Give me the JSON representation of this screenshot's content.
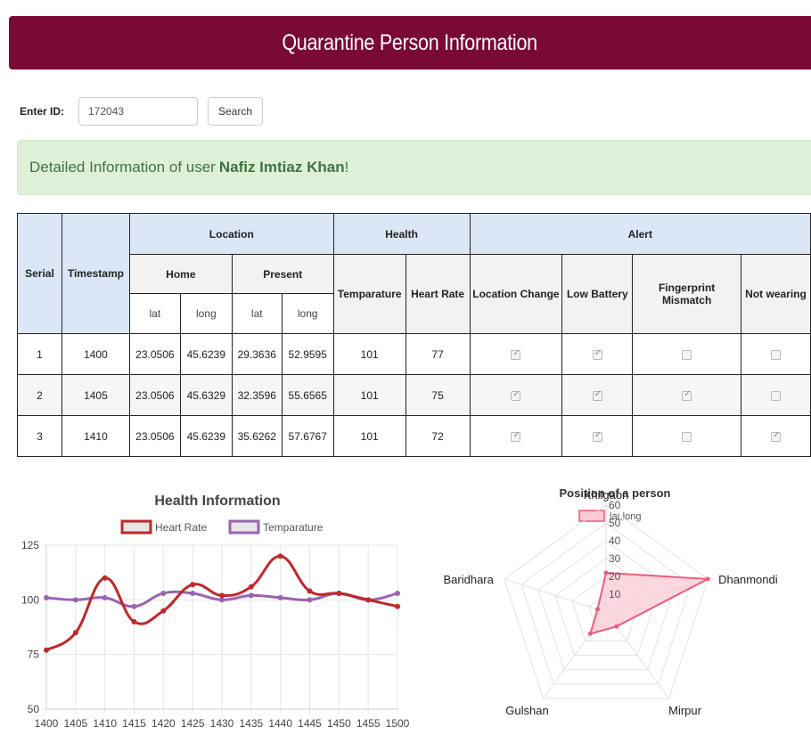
{
  "header": {
    "title": "Quarantine Person Information"
  },
  "search": {
    "label": "Enter ID:",
    "value": "172043",
    "button": "Search"
  },
  "alert": {
    "prefix": "Detailed Information of user ",
    "user": "Nafiz Imtiaz Khan",
    "suffix": "!"
  },
  "table": {
    "headers": {
      "serial": "Serial",
      "timestamp": "Timestamp",
      "location": "Location",
      "health": "Health",
      "alert": "Alert",
      "home": "Home",
      "present": "Present",
      "temperature": "Temparature",
      "heart_rate": "Heart Rate",
      "location_change": "Location Change",
      "low_battery": "Low Battery",
      "fingerprint": "Fingerprint Mismatch",
      "not_wearing": "Not wearing",
      "lat": "lat",
      "long": "long"
    },
    "rows": [
      {
        "serial": "1",
        "timestamp": "1400",
        "home_lat": "23.0506",
        "home_long": "45.6239",
        "present_lat": "29.3636",
        "present_long": "52.9595",
        "temp": "101",
        "hr": "77",
        "location_change": true,
        "low_battery": true,
        "fingerprint": false,
        "not_wearing": false
      },
      {
        "serial": "2",
        "timestamp": "1405",
        "home_lat": "23.0506",
        "home_long": "45.6329",
        "present_lat": "32.3596",
        "present_long": "55.6565",
        "temp": "101",
        "hr": "75",
        "location_change": true,
        "low_battery": true,
        "fingerprint": true,
        "not_wearing": false
      },
      {
        "serial": "3",
        "timestamp": "1410",
        "home_lat": "23.0506",
        "home_long": "45.6239",
        "present_lat": "35.6262",
        "present_long": "57.6767",
        "temp": "101",
        "hr": "72",
        "location_change": true,
        "low_battery": true,
        "fingerprint": false,
        "not_wearing": true
      }
    ]
  },
  "colors": {
    "header_bg": "#790935",
    "heart_rate": "#c0282a",
    "temperature": "#9c63b1",
    "radar_line": "#ec5b7d",
    "radar_fill": "#f9c9d4"
  },
  "chart_data": [
    {
      "type": "line",
      "title": "Health Information",
      "x": [
        "1400",
        "1405",
        "1410",
        "1415",
        "1420",
        "1425",
        "1430",
        "1435",
        "1440",
        "1445",
        "1450",
        "1455",
        "1500"
      ],
      "series": [
        {
          "name": "Heart Rate",
          "values": [
            77,
            85,
            110,
            90,
            95,
            107,
            102,
            106,
            120,
            104,
            103,
            100,
            97
          ]
        },
        {
          "name": "Temparature",
          "values": [
            101,
            100,
            101,
            97,
            103,
            103,
            100,
            102,
            101,
            100,
            103,
            100,
            103
          ]
        }
      ],
      "ylim": [
        50,
        125
      ],
      "yticks": [
        "125",
        "100",
        "75",
        "50"
      ],
      "grid": true,
      "legend": "top"
    },
    {
      "type": "radar",
      "title": "Position of a person",
      "categories": [
        "Khilgaon",
        "Dhanmondi",
        "Mirpur",
        "Gulshan",
        "Baridhara"
      ],
      "series": [
        {
          "name": "lat,long",
          "values": [
            22,
            60,
            10,
            15,
            5
          ]
        }
      ],
      "rlim": [
        0,
        60
      ],
      "rticks": [
        "10",
        "20",
        "30",
        "40",
        "50",
        "60"
      ],
      "legend": "top"
    }
  ]
}
